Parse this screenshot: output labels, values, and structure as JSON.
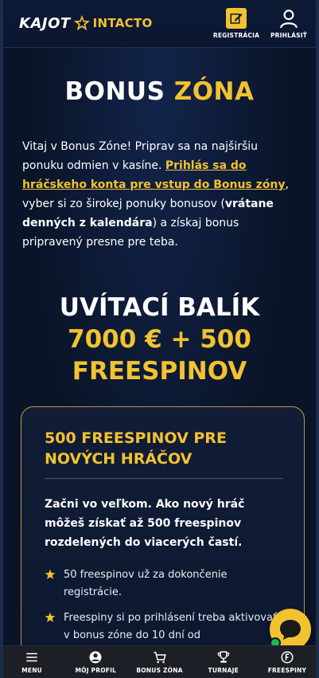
{
  "header": {
    "logo_text_1": "KAJOT",
    "logo_text_2": "INTACTO",
    "register_label": "REGISTRÁCIA",
    "login_label": "PRIHLÁSIŤ"
  },
  "bonus_zone": {
    "title_white": "BONUS",
    "title_yellow": "ZÓNA",
    "intro_1": "Vitaj v Bonus Zóne! Priprav sa na najširšiu ponuku odmien v kasíne. ",
    "intro_link": "Prihlás sa do hráčskeho konta pre vstup do Bonus zóny",
    "intro_2": ", vyber si zo širokej ponuky bonusov (",
    "intro_bold": "vrátane denných z kalendára",
    "intro_3": ") a získaj bonus pripravený presne pre teba."
  },
  "welcome_package": {
    "line1": "UVÍTACÍ BALÍK",
    "line2": "7000 € + 500",
    "line3": "FREESPINOV"
  },
  "card": {
    "title": "500 FREESPINOV PRE NOVÝCH HRÁČOV",
    "text": "Začni vo veľkom. Ako nový hráč môžeš získať až 500 freespinov rozdelených do viacerých častí.",
    "bullets": [
      "50 freespinov už za dokončenie registrácie.",
      "Freespiny si po prihlásení treba aktivovať v bonus zóne do 10 dní od"
    ]
  },
  "bottom_nav": {
    "menu": "MENU",
    "profile": "MÔJ PROFIL",
    "bonus": "BONUS ZÓNA",
    "tournaments": "TURNAJE",
    "freespins": "FREESPINY"
  },
  "colors": {
    "accent": "#f2c230",
    "background": "#0a1428",
    "nav_background": "#1c1f26",
    "online_dot": "#1db954"
  },
  "icons": {
    "logo_star": "star-icon",
    "register": "pencil-square-icon",
    "login": "user-icon",
    "chat": "chat-bubble-icon",
    "menu": "hamburger-icon",
    "profile": "user-circle-icon",
    "bonus": "cart-icon",
    "tournaments": "trophy-icon",
    "freespins": "spin-icon",
    "bullet": "star-icon"
  }
}
